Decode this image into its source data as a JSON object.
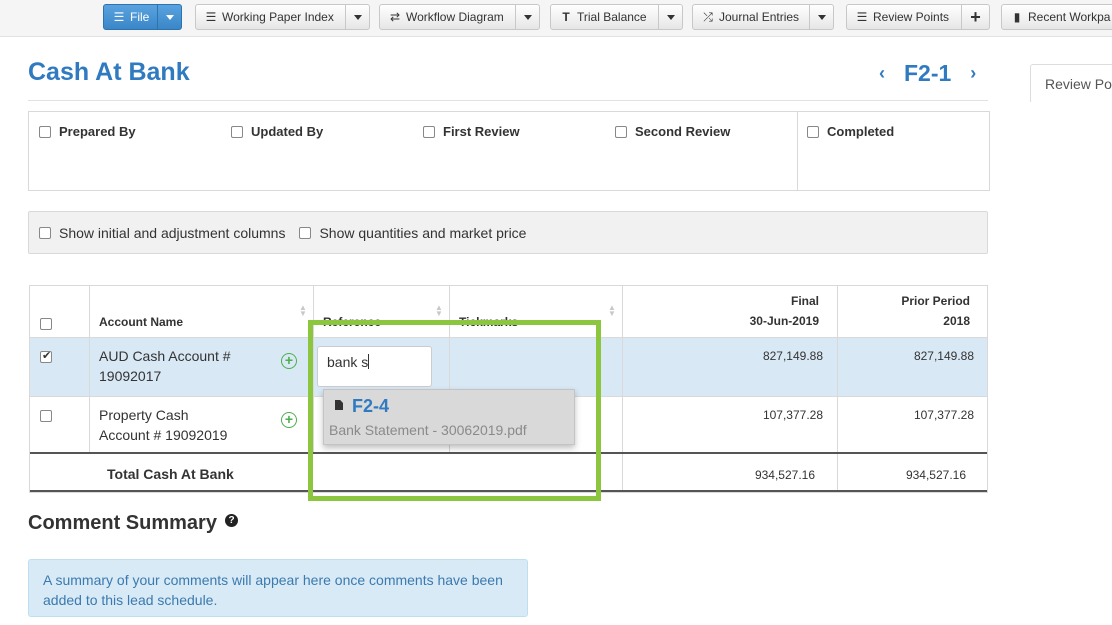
{
  "toolbar": {
    "file_label": "File",
    "working_paper_index_label": "Working Paper Index",
    "workflow_diagram_label": "Workflow Diagram",
    "trial_balance_label": "Trial Balance",
    "journal_entries_label": "Journal Entries",
    "review_points_label": "Review Points",
    "recent_label": "Recent Workpa"
  },
  "page": {
    "title": "Cash At Bank",
    "reference": "F2-1",
    "side_tab_label": "Review Po"
  },
  "signoff": {
    "prepared_by": "Prepared By",
    "updated_by": "Updated By",
    "first_review": "First Review",
    "second_review": "Second Review",
    "completed": "Completed"
  },
  "options": {
    "show_initial": "Show initial and adjustment columns",
    "show_quantities": "Show quantities and market price"
  },
  "table": {
    "headers": {
      "account_name": "Account Name",
      "reference": "Reference",
      "tickmarks": "Tickmarks",
      "final_line1": "Final",
      "final_line2": "30-Jun-2019",
      "prior_line1": "Prior Period",
      "prior_line2": "2018"
    },
    "rows": [
      {
        "account_line1": "AUD Cash Account #",
        "account_line2": "19092017",
        "final": "827,149.88",
        "prior": "827,149.88",
        "checked": true
      },
      {
        "account_line1": "Property Cash",
        "account_line2": "Account # 19092019",
        "final": "107,377.28",
        "prior": "107,377.28",
        "checked": false
      }
    ],
    "total": {
      "label": "Total Cash At Bank",
      "final": "934,527.16",
      "prior": "934,527.16"
    }
  },
  "autocomplete": {
    "input_value": "bank s",
    "result_code": "F2-4",
    "result_name": "Bank Statement - 30062019.pdf"
  },
  "comment_summary": {
    "title": "Comment Summary",
    "message": "A summary of your comments will appear here once comments have been added to this lead schedule."
  },
  "colors": {
    "accent_blue": "#2f7ac0",
    "highlight_green": "#8cc63f",
    "selected_row": "#d9e8f5"
  }
}
